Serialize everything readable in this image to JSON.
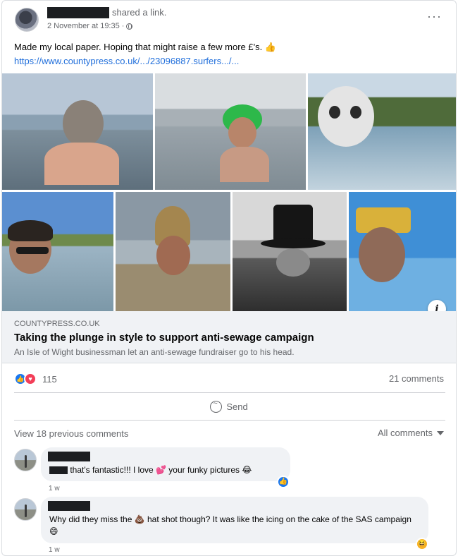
{
  "post": {
    "shared_text": "shared a link.",
    "timestamp": "2 November at 19:35 ·",
    "more_label": "···",
    "text": "Made my local paper. Hoping that might raise a few more £'s. 👍",
    "link": "https://www.countypress.co.uk/.../23096887.surfers.../..."
  },
  "preview": {
    "domain": "COUNTYPRESS.CO.UK",
    "title": "Taking the plunge in style to support anti-sewage campaign",
    "subtitle": "An Isle of Wight businessman let an anti-sewage fundraiser go to his head.",
    "info_label": "i"
  },
  "reactions": {
    "count": "115",
    "comments": "21 comments",
    "like_glyph": "👍",
    "love_glyph": "♥"
  },
  "actions": {
    "send_label": "Send"
  },
  "comments_section": {
    "view_previous": "View 18 previous comments",
    "filter_label": "All comments"
  },
  "comments": [
    {
      "text_after_redaction": " that's fantastic!!! I love ",
      "emoji1": "💕",
      "text2": " your funky pictures ",
      "emoji2": "😂",
      "time": "1 w",
      "reaction": "👍"
    },
    {
      "text": "Why did they miss the ",
      "emoji1": "💩",
      "text2": " hat shot though? It was like the icing on the cake of the SAS campaign ",
      "emoji2": "😄",
      "time": "1 w",
      "reaction": "😆"
    }
  ],
  "colors": {
    "link": "#216fdb",
    "like_blue": "#1877f2",
    "love_red": "#f33e58",
    "muted": "#65676b"
  },
  "icons": {
    "privacy": "globe-icon",
    "send": "messenger-icon",
    "info": "info-icon",
    "dropdown": "caret-down-icon"
  }
}
